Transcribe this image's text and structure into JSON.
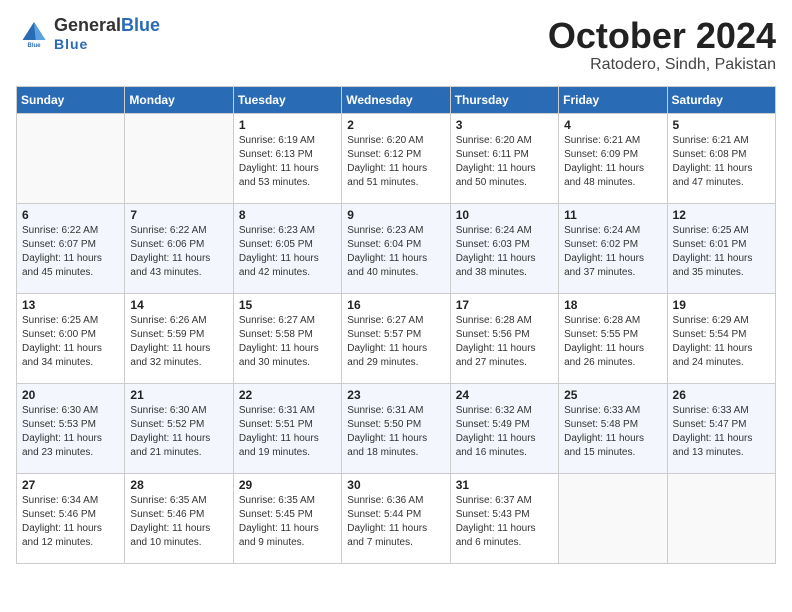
{
  "header": {
    "logo_general": "General",
    "logo_blue": "Blue",
    "month_title": "October 2024",
    "location": "Ratodero, Sindh, Pakistan"
  },
  "weekdays": [
    "Sunday",
    "Monday",
    "Tuesday",
    "Wednesday",
    "Thursday",
    "Friday",
    "Saturday"
  ],
  "weeks": [
    [
      {
        "day": "",
        "info": ""
      },
      {
        "day": "",
        "info": ""
      },
      {
        "day": "1",
        "sunrise": "Sunrise: 6:19 AM",
        "sunset": "Sunset: 6:13 PM",
        "daylight": "Daylight: 11 hours and 53 minutes."
      },
      {
        "day": "2",
        "sunrise": "Sunrise: 6:20 AM",
        "sunset": "Sunset: 6:12 PM",
        "daylight": "Daylight: 11 hours and 51 minutes."
      },
      {
        "day": "3",
        "sunrise": "Sunrise: 6:20 AM",
        "sunset": "Sunset: 6:11 PM",
        "daylight": "Daylight: 11 hours and 50 minutes."
      },
      {
        "day": "4",
        "sunrise": "Sunrise: 6:21 AM",
        "sunset": "Sunset: 6:09 PM",
        "daylight": "Daylight: 11 hours and 48 minutes."
      },
      {
        "day": "5",
        "sunrise": "Sunrise: 6:21 AM",
        "sunset": "Sunset: 6:08 PM",
        "daylight": "Daylight: 11 hours and 47 minutes."
      }
    ],
    [
      {
        "day": "6",
        "sunrise": "Sunrise: 6:22 AM",
        "sunset": "Sunset: 6:07 PM",
        "daylight": "Daylight: 11 hours and 45 minutes."
      },
      {
        "day": "7",
        "sunrise": "Sunrise: 6:22 AM",
        "sunset": "Sunset: 6:06 PM",
        "daylight": "Daylight: 11 hours and 43 minutes."
      },
      {
        "day": "8",
        "sunrise": "Sunrise: 6:23 AM",
        "sunset": "Sunset: 6:05 PM",
        "daylight": "Daylight: 11 hours and 42 minutes."
      },
      {
        "day": "9",
        "sunrise": "Sunrise: 6:23 AM",
        "sunset": "Sunset: 6:04 PM",
        "daylight": "Daylight: 11 hours and 40 minutes."
      },
      {
        "day": "10",
        "sunrise": "Sunrise: 6:24 AM",
        "sunset": "Sunset: 6:03 PM",
        "daylight": "Daylight: 11 hours and 38 minutes."
      },
      {
        "day": "11",
        "sunrise": "Sunrise: 6:24 AM",
        "sunset": "Sunset: 6:02 PM",
        "daylight": "Daylight: 11 hours and 37 minutes."
      },
      {
        "day": "12",
        "sunrise": "Sunrise: 6:25 AM",
        "sunset": "Sunset: 6:01 PM",
        "daylight": "Daylight: 11 hours and 35 minutes."
      }
    ],
    [
      {
        "day": "13",
        "sunrise": "Sunrise: 6:25 AM",
        "sunset": "Sunset: 6:00 PM",
        "daylight": "Daylight: 11 hours and 34 minutes."
      },
      {
        "day": "14",
        "sunrise": "Sunrise: 6:26 AM",
        "sunset": "Sunset: 5:59 PM",
        "daylight": "Daylight: 11 hours and 32 minutes."
      },
      {
        "day": "15",
        "sunrise": "Sunrise: 6:27 AM",
        "sunset": "Sunset: 5:58 PM",
        "daylight": "Daylight: 11 hours and 30 minutes."
      },
      {
        "day": "16",
        "sunrise": "Sunrise: 6:27 AM",
        "sunset": "Sunset: 5:57 PM",
        "daylight": "Daylight: 11 hours and 29 minutes."
      },
      {
        "day": "17",
        "sunrise": "Sunrise: 6:28 AM",
        "sunset": "Sunset: 5:56 PM",
        "daylight": "Daylight: 11 hours and 27 minutes."
      },
      {
        "day": "18",
        "sunrise": "Sunrise: 6:28 AM",
        "sunset": "Sunset: 5:55 PM",
        "daylight": "Daylight: 11 hours and 26 minutes."
      },
      {
        "day": "19",
        "sunrise": "Sunrise: 6:29 AM",
        "sunset": "Sunset: 5:54 PM",
        "daylight": "Daylight: 11 hours and 24 minutes."
      }
    ],
    [
      {
        "day": "20",
        "sunrise": "Sunrise: 6:30 AM",
        "sunset": "Sunset: 5:53 PM",
        "daylight": "Daylight: 11 hours and 23 minutes."
      },
      {
        "day": "21",
        "sunrise": "Sunrise: 6:30 AM",
        "sunset": "Sunset: 5:52 PM",
        "daylight": "Daylight: 11 hours and 21 minutes."
      },
      {
        "day": "22",
        "sunrise": "Sunrise: 6:31 AM",
        "sunset": "Sunset: 5:51 PM",
        "daylight": "Daylight: 11 hours and 19 minutes."
      },
      {
        "day": "23",
        "sunrise": "Sunrise: 6:31 AM",
        "sunset": "Sunset: 5:50 PM",
        "daylight": "Daylight: 11 hours and 18 minutes."
      },
      {
        "day": "24",
        "sunrise": "Sunrise: 6:32 AM",
        "sunset": "Sunset: 5:49 PM",
        "daylight": "Daylight: 11 hours and 16 minutes."
      },
      {
        "day": "25",
        "sunrise": "Sunrise: 6:33 AM",
        "sunset": "Sunset: 5:48 PM",
        "daylight": "Daylight: 11 hours and 15 minutes."
      },
      {
        "day": "26",
        "sunrise": "Sunrise: 6:33 AM",
        "sunset": "Sunset: 5:47 PM",
        "daylight": "Daylight: 11 hours and 13 minutes."
      }
    ],
    [
      {
        "day": "27",
        "sunrise": "Sunrise: 6:34 AM",
        "sunset": "Sunset: 5:46 PM",
        "daylight": "Daylight: 11 hours and 12 minutes."
      },
      {
        "day": "28",
        "sunrise": "Sunrise: 6:35 AM",
        "sunset": "Sunset: 5:46 PM",
        "daylight": "Daylight: 11 hours and 10 minutes."
      },
      {
        "day": "29",
        "sunrise": "Sunrise: 6:35 AM",
        "sunset": "Sunset: 5:45 PM",
        "daylight": "Daylight: 11 hours and 9 minutes."
      },
      {
        "day": "30",
        "sunrise": "Sunrise: 6:36 AM",
        "sunset": "Sunset: 5:44 PM",
        "daylight": "Daylight: 11 hours and 7 minutes."
      },
      {
        "day": "31",
        "sunrise": "Sunrise: 6:37 AM",
        "sunset": "Sunset: 5:43 PM",
        "daylight": "Daylight: 11 hours and 6 minutes."
      },
      {
        "day": "",
        "info": ""
      },
      {
        "day": "",
        "info": ""
      }
    ]
  ]
}
